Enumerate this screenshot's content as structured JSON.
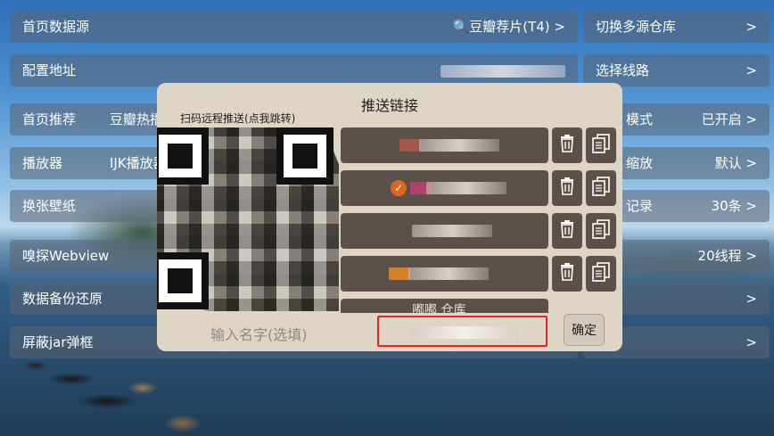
{
  "settings": {
    "home_source": {
      "label": "首页数据源",
      "value": "🔍豆瓣荐片(T4)",
      "chevron": ">"
    },
    "config_url": {
      "label": "配置地址"
    },
    "home_recommend": {
      "label": "首页推荐",
      "value": "豆瓣热播"
    },
    "player": {
      "label": "播放器",
      "value": "IJK播放器"
    },
    "wallpaper": {
      "label": "换张壁纸"
    },
    "sniff_webview": {
      "label": "嗅探Webview"
    },
    "backup_restore": {
      "label": "数据备份还原",
      "chevron": ">"
    },
    "block_jar_popup": {
      "label": "屏蔽jar弹框",
      "chevron": ">"
    },
    "switch_repo": {
      "label": "切换多源仓库",
      "chevron": ">"
    },
    "select_line": {
      "label": "选择线路",
      "chevron": ">"
    },
    "mode": {
      "label": "模式",
      "value": "已开启",
      "chevron": ">"
    },
    "scale": {
      "label": "缩放",
      "value": "默认",
      "chevron": ">"
    },
    "history": {
      "label": "记录",
      "value": "30条",
      "chevron": ">"
    },
    "threads": {
      "value": "20线程",
      "chevron": ">"
    },
    "right_blank1": {
      "chevron": ">"
    },
    "right_blank2": {
      "chevron": ">"
    }
  },
  "dialog": {
    "title": "推送链接",
    "qr_caption": "扫码远程推送(点我跳转)",
    "name_placeholder": "输入名字(选填)",
    "confirm_label": "确定",
    "partial_item_text": "嘟嘟 仓库"
  },
  "colors": {
    "accent_orange": "#e0661e",
    "highlight_red": "#e0252a",
    "dialog_bg": "#ded5c5",
    "item_bg": "#5a524a"
  },
  "icons": {
    "trash": "trash-icon",
    "copy": "copy-icon",
    "check": "check-circle-icon"
  }
}
